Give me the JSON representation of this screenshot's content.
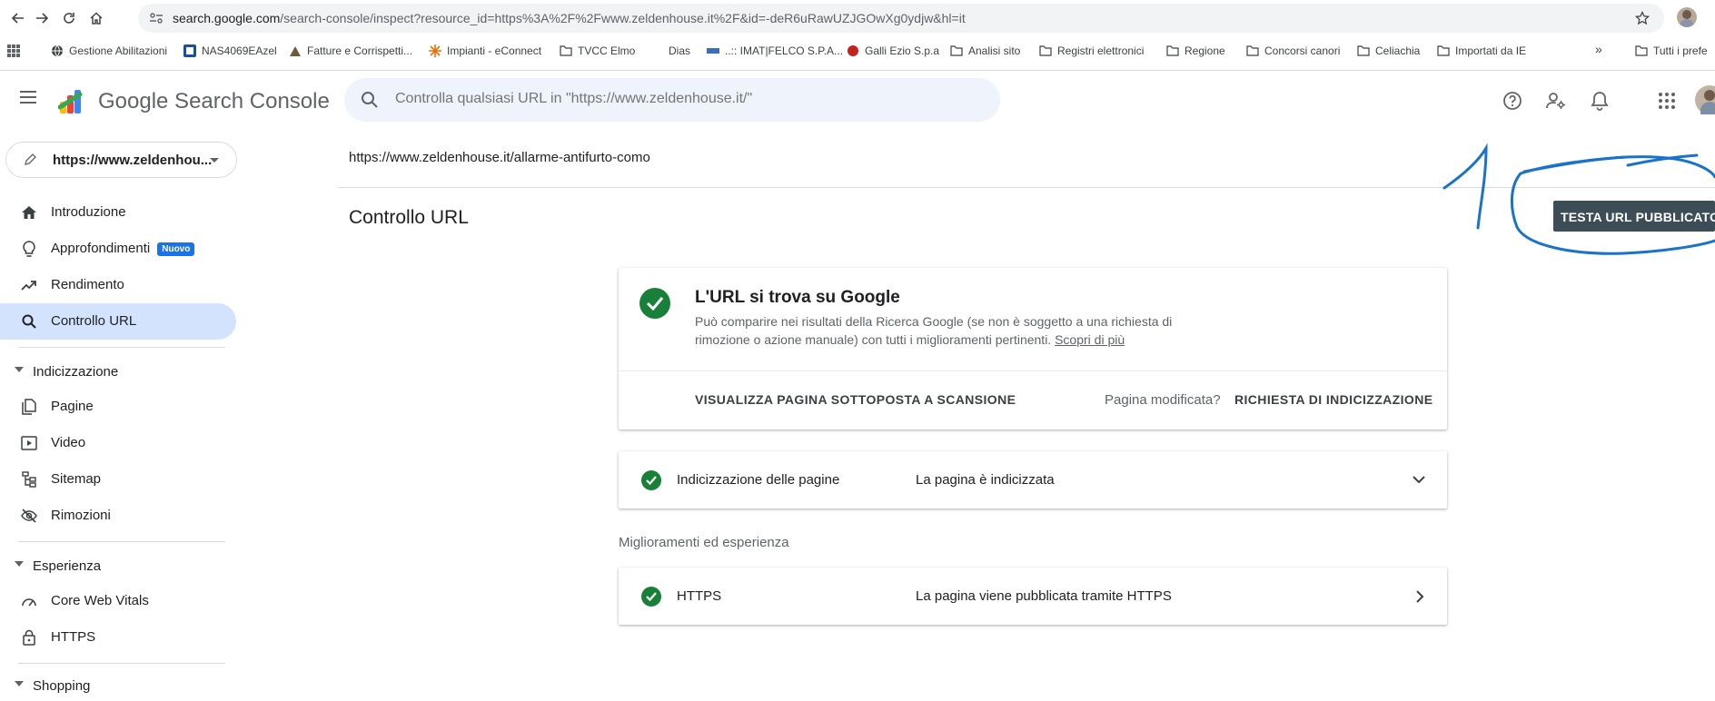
{
  "browser": {
    "url_host": "search.google.com",
    "url_rest": "/search-console/inspect?resource_id=https%3A%2F%2Fwww.zeldenhouse.it%2F&id=-deR6uRawUZJGOwXg0ydjw&hl=it",
    "bookmarks": [
      {
        "label": "Gestione Abilitazioni",
        "icon": "globe-icon"
      },
      {
        "label": "NAS4069EAzel",
        "icon": "nas-icon"
      },
      {
        "label": "Fatture e Corrispetti...",
        "icon": "invoice-icon"
      },
      {
        "label": "Impianti - eConnect",
        "icon": "econnect-icon"
      },
      {
        "label": "TVCC Elmo",
        "icon": "folder-icon"
      },
      {
        "label": "Dias",
        "icon": "blank-icon"
      },
      {
        "label": "..:: IMAT|FELCO S.P.A...",
        "icon": "imat-icon"
      },
      {
        "label": "Galli Ezio S.p.a",
        "icon": "galli-icon"
      },
      {
        "label": "Analisi sito",
        "icon": "folder-icon"
      },
      {
        "label": "Registri elettronici",
        "icon": "folder-icon"
      },
      {
        "label": "Regione",
        "icon": "folder-icon"
      },
      {
        "label": "Concorsi canori",
        "icon": "folder-icon"
      },
      {
        "label": "Celiachia",
        "icon": "folder-icon"
      },
      {
        "label": "Importati da IE",
        "icon": "folder-icon"
      }
    ],
    "more_bookmarks": "»",
    "other_bookmarks": "Tutti i prefe"
  },
  "header": {
    "product_name": "Google Search Console",
    "search_placeholder": "Controlla qualsiasi URL in \"https://www.zeldenhouse.it/\""
  },
  "sidebar": {
    "property": "https://www.zeldenhou...",
    "items": [
      {
        "label": "Introduzione",
        "icon": "home-icon"
      },
      {
        "label": "Approfondimenti",
        "icon": "lightbulb-icon",
        "badge": "Nuovo"
      },
      {
        "label": "Rendimento",
        "icon": "trending-up-icon"
      },
      {
        "label": "Controllo URL",
        "icon": "search-icon",
        "active": true
      }
    ],
    "sections": [
      {
        "title": "Indicizzazione",
        "items": [
          {
            "label": "Pagine",
            "icon": "pages-icon"
          },
          {
            "label": "Video",
            "icon": "video-icon"
          },
          {
            "label": "Sitemap",
            "icon": "sitemap-icon"
          },
          {
            "label": "Rimozioni",
            "icon": "eye-off-icon"
          }
        ]
      },
      {
        "title": "Esperienza",
        "items": [
          {
            "label": "Core Web Vitals",
            "icon": "speed-icon"
          },
          {
            "label": "HTTPS",
            "icon": "lock-icon"
          }
        ]
      },
      {
        "title": "Shopping",
        "items": []
      }
    ]
  },
  "main": {
    "inspected_url": "https://www.zeldenhouse.it/allarme-antifurto-como",
    "page_title": "Controllo URL",
    "test_button": "TESTA URL PUBBLICATO",
    "status_card": {
      "title": "L'URL si trova su Google",
      "desc_line1": "Può comparire nei risultati della Ricerca Google (se non è soggetto a una richiesta di",
      "desc_line2": "rimozione o azione manuale) con tutti i miglioramenti pertinenti.",
      "learn_more": "Scopri di più",
      "view_crawled": "VISUALIZZA PAGINA SOTTOPOSTA A SCANSIONE",
      "page_changed": "Pagina modificata?",
      "request_indexing": "RICHIESTA DI INDICIZZAZIONE"
    },
    "indexing_row": {
      "label": "Indicizzazione delle pagine",
      "value": "La pagina è indicizzata"
    },
    "improvements_heading": "Miglioramenti ed esperienza",
    "https_row": {
      "label": "HTTPS",
      "value": "La pagina viene pubblicata tramite HTTPS"
    }
  },
  "colors": {
    "accent": "#1a73e8",
    "success": "#188038",
    "annotation": "#1a73c8"
  }
}
